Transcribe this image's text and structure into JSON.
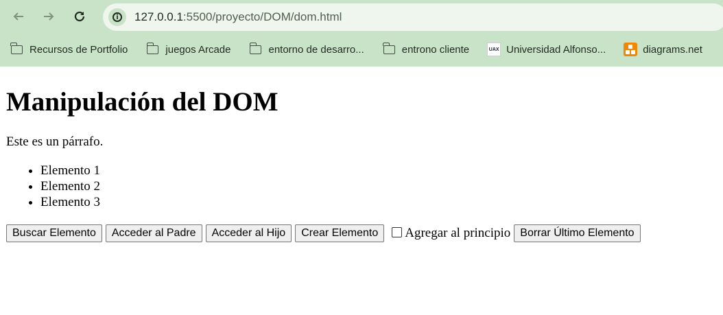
{
  "browser": {
    "url_host": "127.0.0.1",
    "url_rest": ":5500/proyecto/DOM/dom.html",
    "bookmarks": [
      {
        "label": "Recursos de Portfolio",
        "icon": "folder-icon"
      },
      {
        "label": "juegos Arcade",
        "icon": "folder-icon"
      },
      {
        "label": "entorno de desarro...",
        "icon": "folder-icon"
      },
      {
        "label": "entrono cliente",
        "icon": "folder-icon"
      },
      {
        "label": "Universidad Alfonso...",
        "icon": "uax-icon",
        "icon_text": "UAX"
      },
      {
        "label": "diagrams.net",
        "icon": "diagrams-icon"
      }
    ]
  },
  "page": {
    "title": "Manipulación del DOM",
    "paragraph": "Este es un párrafo.",
    "list": [
      "Elemento 1",
      "Elemento 2",
      "Elemento 3"
    ],
    "buttons": {
      "buscar": "Buscar Elemento",
      "padre": "Acceder al Padre",
      "hijo": "Acceder al Hijo",
      "crear": "Crear Elemento",
      "borrar": "Borrar Último Elemento"
    },
    "checkbox_label": "Agregar al principio"
  }
}
